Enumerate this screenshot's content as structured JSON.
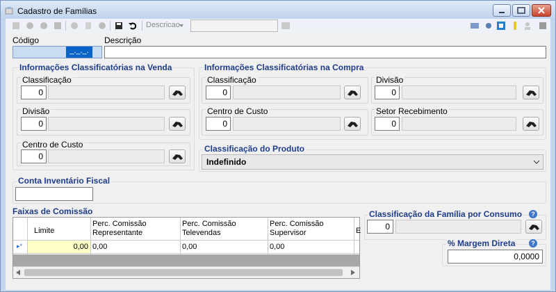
{
  "window": {
    "title": "Cadastro de Famílias"
  },
  "toolbar": {
    "descricao_label": "Descricao",
    "search_value": ""
  },
  "form": {
    "codigo_label": "Código",
    "codigo_value": "_._._.",
    "descricao_label": "Descrição",
    "descricao_value": ""
  },
  "venda": {
    "header": "Informações Classificatórias na Venda",
    "classificacao": {
      "label": "Classificação",
      "value": "0"
    },
    "divisao": {
      "label": "Divisão",
      "value": "0"
    },
    "centro": {
      "label": "Centro de Custo",
      "value": "0"
    }
  },
  "compra": {
    "header": "Informações Classificatórias na Compra",
    "classificacao": {
      "label": "Classificação",
      "value": "0"
    },
    "divisao": {
      "label": "Divisão",
      "value": "0"
    },
    "centro": {
      "label": "Centro de Custo",
      "value": "0"
    },
    "setor": {
      "label": "Setor Recebimento",
      "value": "0"
    }
  },
  "produto": {
    "header": "Classificação do Produto",
    "value": "Indefinido"
  },
  "conta": {
    "header": "Conta Inventário Fiscal",
    "value": ""
  },
  "faixas": {
    "header": "Faixas de Comissão",
    "columns": [
      "Limite",
      "Perc. Comissão\nRepresentante",
      "Perc. Comissão\nTelevendas",
      "Perc. Comissão\nSupervisor",
      "E"
    ],
    "row": [
      "0,00",
      "0,00",
      "0,00",
      "0,00"
    ]
  },
  "consumo": {
    "header": "Classificação da Família por Consumo",
    "value": "0"
  },
  "margem": {
    "header": "% Margem Direta",
    "value": "0,0000"
  },
  "colors": {
    "header_text": "#1f3c88",
    "highlight": "#ffffc8",
    "focus": "#0a64c8"
  }
}
